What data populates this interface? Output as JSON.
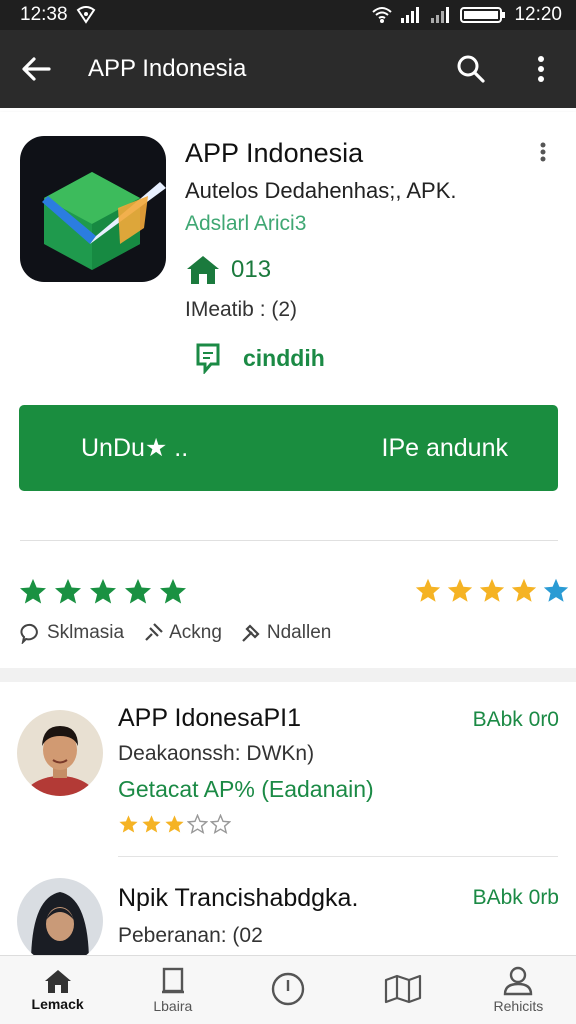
{
  "status": {
    "time_left": "12:38",
    "time_right": "12:20"
  },
  "appbar": {
    "title": "APP Indonesia"
  },
  "app": {
    "name": "APP Indonesia",
    "subtitle": "Autelos Dedahenhas;, APK.",
    "developer": "Adslarl Arici3",
    "rating_value": "013",
    "meta": "IMeatib : (2)",
    "tag": "cinddih",
    "install_left": "UnDu★ ..",
    "install_right": "IPe andunk"
  },
  "ratings": {
    "left_stars": 5,
    "right_stars": 5
  },
  "chips": [
    "Sklmasia",
    "Ackng",
    "Ndallen"
  ],
  "list": [
    {
      "title": "APP IdonesaPI1",
      "price": "BAbk 0r0",
      "sub": "Deakaonssh: DWKn)",
      "green": "Getacat AP% (Eadanain)",
      "stars": 3
    },
    {
      "title": "Npik Trancishabdgka.",
      "price": "BAbk 0rb",
      "sub": "Peberanan: (02"
    }
  ],
  "nav": [
    "Lemack",
    "Lbaira",
    "",
    "",
    "Rehicits"
  ],
  "colors": {
    "accent": "#1a8d3f",
    "appbar": "#2b2b2b",
    "star_green": "#1a9142",
    "star_gold": "#f5b324"
  }
}
